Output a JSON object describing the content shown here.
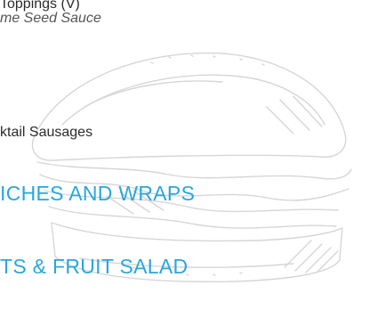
{
  "menu": {
    "cut_line": "Toppings (V)",
    "sauce_line": "me Seed Sauce",
    "item_line": "ktail Sausages",
    "headings": [
      "ICHES AND WRAPS",
      "TS & FRUIT SALAD"
    ]
  },
  "illustration": {
    "icon": "sandwich-sketch-icon",
    "stroke_color": "#d0d0d0"
  },
  "colors": {
    "heading": "#2aa6dc",
    "body_text": "#2b2b2b",
    "italic_text": "#555555"
  }
}
